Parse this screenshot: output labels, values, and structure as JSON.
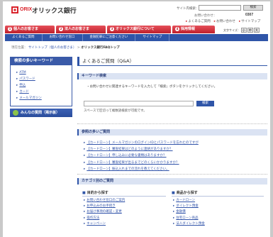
{
  "header": {
    "logo_en": "ORIX",
    "logo_jp": "オリックス銀行",
    "site_search_label": "サイト内検索：",
    "site_search_button": "検索",
    "tel_label": "お問い合わせ：",
    "tel_number": "0307",
    "util_links": [
      "よくあるご質問",
      "お問い合わせ",
      "サイトマップ"
    ],
    "text_size_label": "文字サイズ：",
    "text_size_options": [
      "小",
      "中",
      "大"
    ],
    "brand_color": "#d9222a"
  },
  "nav": {
    "tabs": [
      {
        "num": "1",
        "label": "個人のお客さま"
      },
      {
        "num": "2",
        "label": "法人のお客さま"
      },
      {
        "num": "3",
        "label": "オリックス銀行について"
      },
      {
        "num": "4",
        "label": "採用情報"
      }
    ],
    "sub": [
      "よくあるご質問",
      "お問い合わせ窓口",
      "金融犯罪にご注意ください",
      "サイトマップ"
    ]
  },
  "breadcrumb": {
    "label": "現在位置：",
    "items": [
      "サイトトップ（個人のお客さま）",
      "オリックス銀行FAQトップ"
    ]
  },
  "sidebar": {
    "title": "検索の多いキーワード",
    "items": [
      "ATM",
      "パスワード",
      "申込",
      "カード",
      "メールマガジン"
    ],
    "button": "みんなの質問（掲示板）"
  },
  "main": {
    "title": "よくあるご質問（Q&A）",
    "keyword": {
      "heading": "キーワード検索",
      "desc": "・お問い合わせに関連するキーワードを入力して「検索」ボタンをクリックしてください。",
      "input_value": "",
      "button": "検索",
      "note": "スペースで区切って複数語検索が可能です。"
    },
    "faq": {
      "heading": "参照の多いご質問",
      "items": [
        "【カードローン】メールマガジンのログインIDとパスワードを忘れたのですが",
        "【カードローン】審査結果はどのように連絡がありますか？",
        "【カードローン】申し込みに必要な書類はありますか？",
        "【カードローン】審査結果が出るまでどのくらいかかりますか？",
        "【カードローン】振込入れまでの流れを教えてください。"
      ]
    },
    "categories": {
      "heading": "カテゴリ別のご質問",
      "purpose_title": "目的から探す",
      "purpose_items": [
        "お問い合わせ窓口のご案内",
        "お申込みのお手続き",
        "お届け事項の確認・変更",
        "操作方法",
        "キャンペーン"
      ],
      "product_title": "商品から探す",
      "product_items": [
        "カードローン",
        "ダイレクト預金",
        "金融債",
        "住宅ローン商品",
        "法人ダイレクト預金"
      ]
    }
  }
}
